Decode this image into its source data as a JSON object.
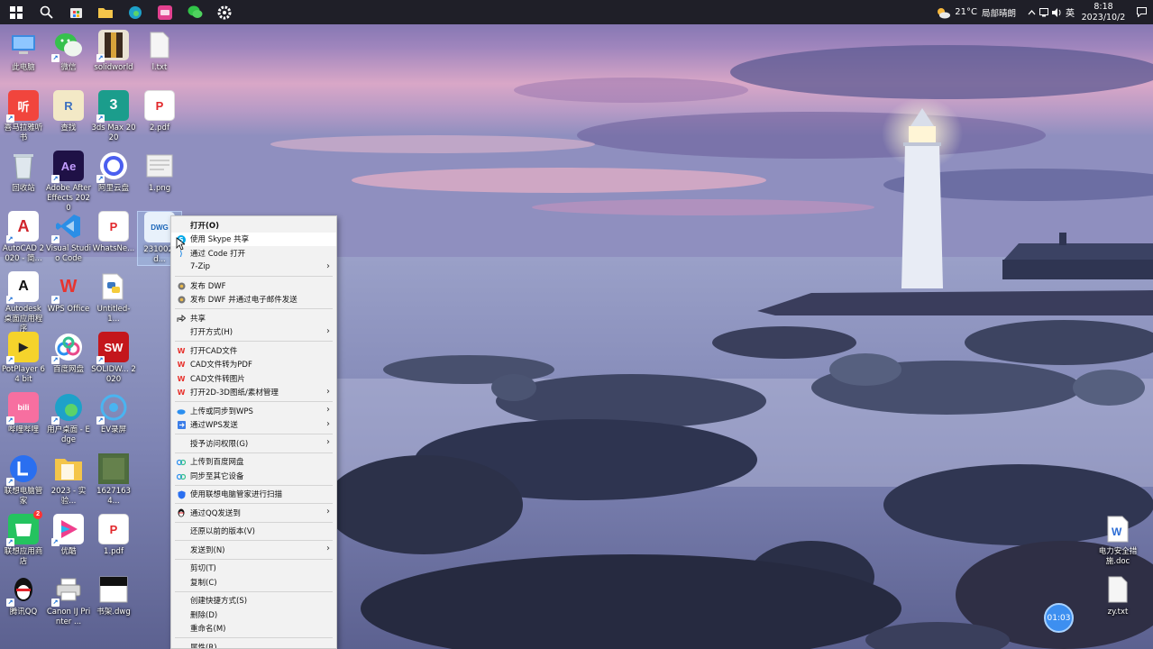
{
  "taskbar": {
    "weather_temp": "21°C",
    "weather_text": "局部晴朗",
    "ime": "英",
    "time": "8:18",
    "date": "2023/10/2"
  },
  "desktop_icons": [
    {
      "label": "此电脑"
    },
    {
      "label": "微信"
    },
    {
      "label": "solidworld"
    },
    {
      "label": "l.txt"
    },
    {
      "label": "喜马拉雅听书"
    },
    {
      "label": "查找"
    },
    {
      "label": "3ds Max 2020"
    },
    {
      "label": "2.pdf"
    },
    {
      "label": "回收站"
    },
    {
      "label": "Adobe After Effects 2020"
    },
    {
      "label": "阿里云盘"
    },
    {
      "label": "1.png"
    },
    {
      "label": "AutoCAD 2020 - 简..."
    },
    {
      "label": "Visual Studio Code"
    },
    {
      "label": "WhatsNe..."
    },
    {
      "label": "231002.d..."
    },
    {
      "label": "Autodesk 桌面应用程序"
    },
    {
      "label": "WPS Office"
    },
    {
      "label": "Untitled-1..."
    },
    {
      "label": "PotPlayer 64 bit"
    },
    {
      "label": "百度网盘"
    },
    {
      "label": "SOLIDW... 2020"
    },
    {
      "label": "哔哩哔哩"
    },
    {
      "label": "用户桌面 - Edge"
    },
    {
      "label": "EV录屏"
    },
    {
      "label": "联想电脑管家"
    },
    {
      "label": "2023 - 实验..."
    },
    {
      "label": "16271634..."
    },
    {
      "label": "联想应用商店"
    },
    {
      "label": "优酷"
    },
    {
      "label": "1.pdf"
    },
    {
      "label": "腾讯QQ"
    },
    {
      "label": "Canon IJ Printer ..."
    },
    {
      "label": "书架.dwg"
    },
    {
      "label": "电力安全措施.doc"
    },
    {
      "label": "zy.txt"
    }
  ],
  "context_menu": {
    "items": [
      {
        "label": "打开(O)"
      },
      {
        "label": "使用 Skype 共享"
      },
      {
        "label": "通过 Code 打开"
      },
      {
        "label": "7-Zip"
      },
      {
        "label": "发布 DWF"
      },
      {
        "label": "发布 DWF 并通过电子邮件发送"
      },
      {
        "label": "共享"
      },
      {
        "label": "打开方式(H)"
      },
      {
        "label": "打开CAD文件"
      },
      {
        "label": "CAD文件转为PDF"
      },
      {
        "label": "CAD文件转图片"
      },
      {
        "label": "打开2D-3D图纸/素材管理"
      },
      {
        "label": "上传或同步到WPS"
      },
      {
        "label": "通过WPS发送"
      },
      {
        "label": "授予访问权限(G)"
      },
      {
        "label": "上传到百度网盘"
      },
      {
        "label": "同步至其它设备"
      },
      {
        "label": "使用联想电脑管家进行扫描"
      },
      {
        "label": "通过QQ发送到"
      },
      {
        "label": "还原以前的版本(V)"
      },
      {
        "label": "发送到(N)"
      },
      {
        "label": "剪切(T)"
      },
      {
        "label": "复制(C)"
      },
      {
        "label": "创建快捷方式(S)"
      },
      {
        "label": "删除(D)"
      },
      {
        "label": "重命名(M)"
      },
      {
        "label": "属性(R)"
      }
    ]
  },
  "recorder_timer": "01:03",
  "badges": {
    "lenovo_store": "2"
  }
}
